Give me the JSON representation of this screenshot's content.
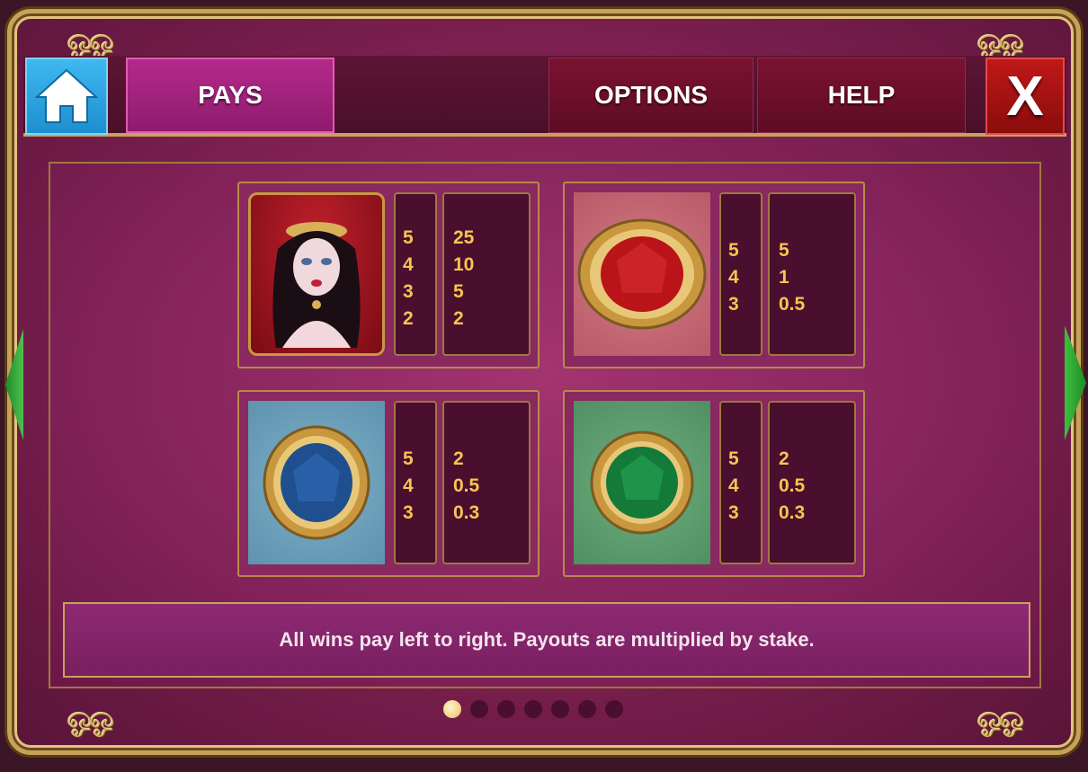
{
  "nav": {
    "tabs": [
      {
        "label": "PAYS",
        "active": true
      },
      {
        "label": "OPTIONS",
        "active": false
      },
      {
        "label": "HELP",
        "active": false
      }
    ],
    "close_label": "X"
  },
  "paytable": [
    {
      "symbol": "lady-portrait",
      "counts": [
        "5",
        "4",
        "3",
        "2"
      ],
      "pays": [
        "25",
        "10",
        "5",
        "2"
      ]
    },
    {
      "symbol": "red-gem",
      "counts": [
        "5",
        "4",
        "3"
      ],
      "pays": [
        "5",
        "1",
        "0.5"
      ]
    },
    {
      "symbol": "blue-gem",
      "counts": [
        "5",
        "4",
        "3"
      ],
      "pays": [
        "2",
        "0.5",
        "0.3"
      ]
    },
    {
      "symbol": "green-gem",
      "counts": [
        "5",
        "4",
        "3"
      ],
      "pays": [
        "2",
        "0.5",
        "0.3"
      ]
    }
  ],
  "note": "All wins pay left to right. Payouts are multiplied by stake.",
  "pagination": {
    "total": 7,
    "current": 1
  },
  "colors": {
    "accent": "#f7c550",
    "active_tab": "#b32a8a",
    "close": "#c01818",
    "home": "#3fb8f0"
  }
}
